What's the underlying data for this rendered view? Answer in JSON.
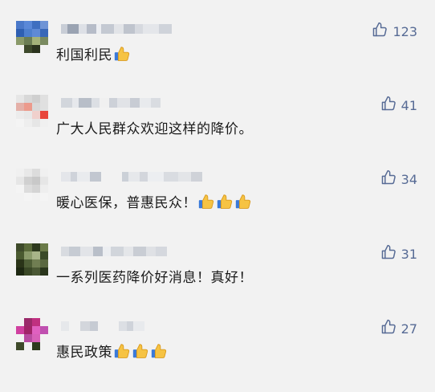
{
  "comments": [
    {
      "text": "利国利民",
      "emoji_count": 1,
      "likes": "123",
      "avatar_colors": [
        "#4a78c9",
        "#5a88d8",
        "#3f6fc0",
        "#6f94d6",
        "#2e5fb2",
        "#4d7fce",
        "#5f8ad6",
        "#3968b8",
        "#8a9a6a",
        "#6b7d54",
        "#a4b27a",
        "#7a8a60",
        "#f2f2f2",
        "#3e4a2c",
        "#2b331e",
        "#f2f2f2"
      ]
    },
    {
      "text": "广大人民群众欢迎这样的降价。",
      "emoji_count": 0,
      "likes": "41",
      "avatar_colors": [
        "#e6e6e6",
        "#d8d8d8",
        "#cfcfcf",
        "#e0e0e0",
        "#e4b0a8",
        "#ec9a8c",
        "#d9d9d9",
        "#e0e0e0",
        "#ececec",
        "#e8e8e8",
        "#f0d0cc",
        "#e8463c",
        "#f4f4f4",
        "#eeeeee",
        "#e6e6e6",
        "#f0f0f0"
      ]
    },
    {
      "text": "暖心医保，普惠民众！",
      "emoji_count": 3,
      "likes": "34",
      "avatar_colors": [
        "#f0f0f0",
        "#e8e8e8",
        "#dcdcdc",
        "#f0f0f0",
        "#e6e6e6",
        "#d0d0d0",
        "#c8c8c8",
        "#e6e6e6",
        "#f4f4f4",
        "#dcdcdc",
        "#d4d4d4",
        "#eeeeee",
        "#f2f2f2",
        "#f4f4f4",
        "#f2f2f2",
        "#f4f4f4"
      ]
    },
    {
      "text": "一系列医药降价好消息！真好！",
      "emoji_count": 0,
      "likes": "31",
      "avatar_colors": [
        "#3e4a2a",
        "#5a6a3a",
        "#2e3a1e",
        "#6a7a48",
        "#4a5a30",
        "#8a9a6a",
        "#a8b488",
        "#3a4a28",
        "#2a3418",
        "#4e5e36",
        "#707e52",
        "#5a6840",
        "#1e2812",
        "#3a4826",
        "#4a5834",
        "#2a361c"
      ]
    },
    {
      "text": "惠民政策",
      "emoji_count": 3,
      "likes": "27",
      "avatar_colors": [
        "#f2f2f2",
        "#9a2a6a",
        "#c03080",
        "#f2f2f2",
        "#d040a0",
        "#a02468",
        "#e060c0",
        "#c050b0",
        "#f2f2f2",
        "#b84aa0",
        "#d860b8",
        "#f2f2f2",
        "#3e4a2a",
        "#f2f2f2",
        "#2e3a1e",
        "#f2f2f2"
      ]
    }
  ],
  "colors": {
    "like": "#576b95",
    "text": "#1a1a1a",
    "background": "#f2f2f2"
  },
  "icons": {
    "like": "thumbs-up-outline-icon",
    "emoji": "thumbs-up-emoji-icon"
  }
}
